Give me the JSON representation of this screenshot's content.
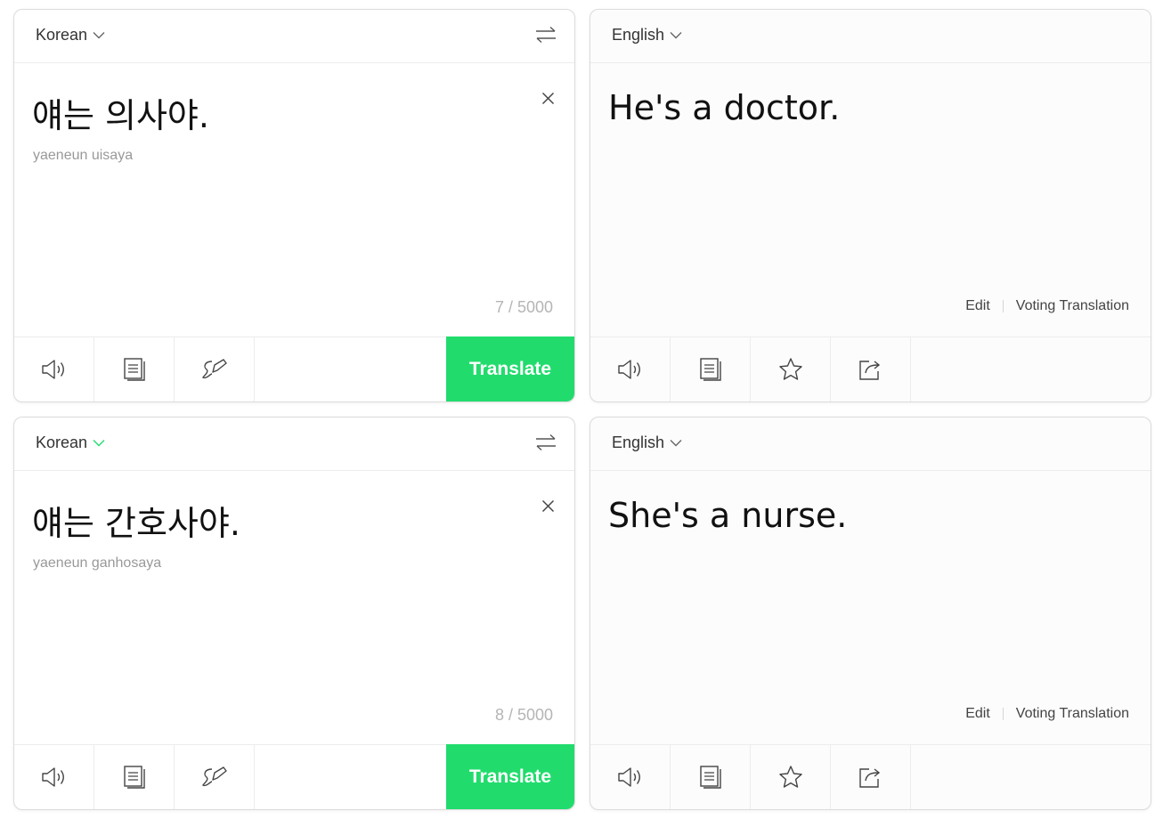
{
  "colors": {
    "accent": "#21dc6d",
    "border": "#dcdcdc",
    "muted": "#999999"
  },
  "pairs": [
    {
      "source": {
        "language": "Korean",
        "language_chevron_color": "#666666",
        "text": "얘는 의사야.",
        "romanization": "yaeneun uisaya",
        "char_count": "7 / 5000",
        "translate_label": "Translate"
      },
      "target": {
        "language": "English",
        "text": "He's a doctor.",
        "edit_label": "Edit",
        "voting_label": "Voting Translation"
      }
    },
    {
      "source": {
        "language": "Korean",
        "language_chevron_color": "#21dc6d",
        "text": "얘는 간호사야.",
        "romanization": "yaeneun ganhosaya",
        "char_count": "8 / 5000",
        "translate_label": "Translate"
      },
      "target": {
        "language": "English",
        "text": "She's a nurse.",
        "edit_label": "Edit",
        "voting_label": "Voting Translation"
      }
    }
  ],
  "icons": {
    "language_dropdown": "chevron-down-icon",
    "swap": "swap-arrows-icon",
    "clear": "close-icon",
    "listen": "speaker-icon",
    "dictionary": "notebook-icon",
    "handwriting": "pen-icon",
    "favorite": "star-icon",
    "share": "share-icon"
  }
}
